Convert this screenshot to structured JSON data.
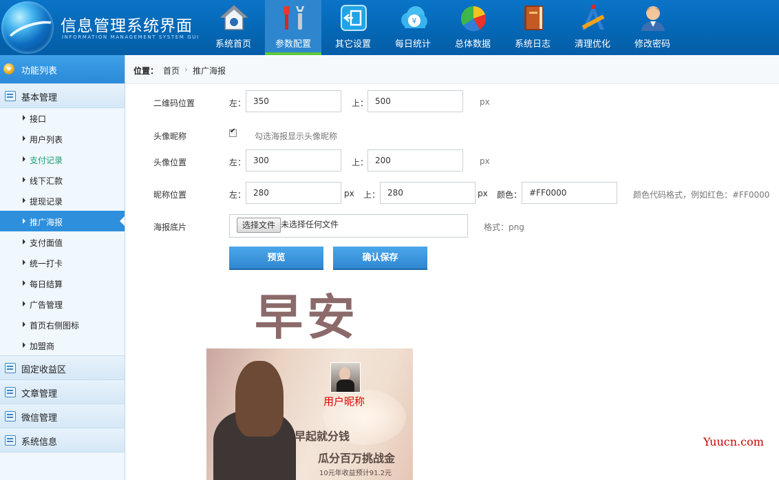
{
  "header": {
    "title": "信息管理系统界面",
    "subtitle": "INFORMATION MANAGEMENT SYSTEM GUI",
    "nav": [
      {
        "label": "系统首页",
        "icon": "home-icon",
        "active": false
      },
      {
        "label": "参数配置",
        "icon": "tools-icon",
        "active": true
      },
      {
        "label": "其它设置",
        "icon": "exit-icon",
        "active": false
      },
      {
        "label": "每日统计",
        "icon": "money-cloud-icon",
        "active": false
      },
      {
        "label": "总体数据",
        "icon": "pie-chart-icon",
        "active": false
      },
      {
        "label": "系统日志",
        "icon": "book-icon",
        "active": false
      },
      {
        "label": "清理优化",
        "icon": "ruler-icon",
        "active": false
      },
      {
        "label": "修改密码",
        "icon": "user-icon",
        "active": false
      }
    ]
  },
  "sidebar": {
    "header": "功能列表",
    "group_basic": "基本管理",
    "items": [
      "接口",
      "用户列表",
      "支付记录",
      "线下汇款",
      "提现记录",
      "推广海报",
      "支付面值",
      "统一打卡",
      "每日结算",
      "广告管理",
      "首页右侧图标",
      "加盟商"
    ],
    "groups": [
      "固定收益区",
      "文章管理",
      "微信管理",
      "系统信息"
    ]
  },
  "breadcrumb": {
    "label": "位置：",
    "home": "首页",
    "separator": "›",
    "current": "推广海报"
  },
  "form": {
    "qr": {
      "label": "二维码位置",
      "left_label": "左：",
      "left_value": "350",
      "top_label": "上：",
      "top_value": "500",
      "unit": "px"
    },
    "avatar_nick": {
      "label": "头像昵称",
      "checked": true,
      "hint": "勾选海报显示头像昵称"
    },
    "avatar_pos": {
      "label": "头像位置",
      "left_label": "左：",
      "left_value": "300",
      "top_label": "上：",
      "top_value": "200",
      "unit": "px"
    },
    "nick_pos": {
      "label": "昵称位置",
      "left_label": "左：",
      "left_value": "280",
      "unit1": "px",
      "top_label": "上：",
      "top_value": "280",
      "unit2": "px",
      "color_label": "颜色：",
      "color_value": "#FF0000",
      "hint": "颜色代码格式，例如红色：#FF0000"
    },
    "poster_bg": {
      "label": "海报底片",
      "button": "选择文件",
      "file_text": "未选择任何文件",
      "hint": "格式：png"
    },
    "preview_btn": "预览",
    "save_btn": "确认保存"
  },
  "poster": {
    "greeting": "早安",
    "nickname": "用户昵称",
    "line1": "早起就分钱",
    "line2": "瓜分百万挑战金",
    "line3": "10元年收益预计91.2元"
  },
  "watermark": "Yuucn.com",
  "colors": {
    "nav_bg": "#0567b5",
    "active_item": "#2e8fdc",
    "highlight_item": "#1a9a7a",
    "nick_color": "#e60000"
  }
}
